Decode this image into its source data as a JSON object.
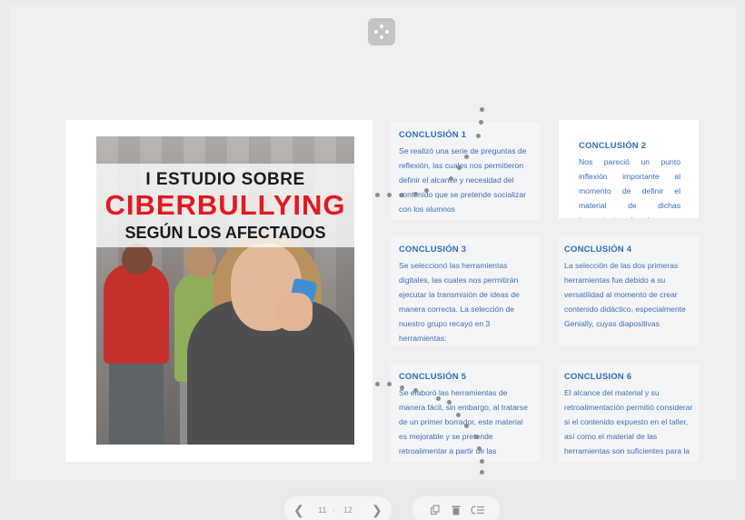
{
  "poster": {
    "line1": "I ESTUDIO SOBRE",
    "line2": "CIBERBULLYING",
    "line3": "SEGÚN LOS AFECTADOS",
    "accent": "#e01a22"
  },
  "conclusions": [
    {
      "title": "CONCLUSIÓN 1",
      "text": "Se realizó una serie de preguntas de reflexión, las cuales nos permitieron definir el alcance y necesidad del contenido que se pretende socializar con los alumnos"
    },
    {
      "title": "CONCLUSIÓN 2",
      "text": "Nos pareció un punto inflexión importante al momento de definir el material de dichas herramientas el cual"
    },
    {
      "title": "CONCLUSIÓN 3",
      "text": "Se seleccionó las herramientas digitales, las cuales nos permitirán ejecutar la transmisión de ideas de manera correcta. La selección de nuestro grupo recayó en 3 herramientas:"
    },
    {
      "title": "CONCLUSIÓN 4",
      "text": "La selección de las dos primeras herramientas fue debido a su versatilidad al momento de crear contenido didáctico, especialmente Genially, cuyas diapositivas"
    },
    {
      "title": "CONCLUSIÓN 5",
      "text": "Se elaboró las herramientas de manera fácil, sin embargo, al tratarse de un primer borrador, este material es mejorable y se pretende retroalimentar a partir de las reacciones y respuestas"
    },
    {
      "title": "CONCLUSION 6",
      "text": "El alcance del material y su retroalimentación permitió considerar si el contenido expuesto en el taller, así como el material de las herramientas son suficientes para la"
    }
  ],
  "pager": {
    "prev_icon": "chevron-left-icon",
    "current": "11",
    "separator": "·",
    "total": "12",
    "next_icon": "chevron-right-icon"
  },
  "toolbar": {
    "icons": [
      "duplicate-icon",
      "trash-icon",
      "reorder-icon"
    ]
  },
  "colors": {
    "card_text": "#3a6fb3",
    "card_title": "#2f6db5",
    "background": "#e9e9e9"
  }
}
